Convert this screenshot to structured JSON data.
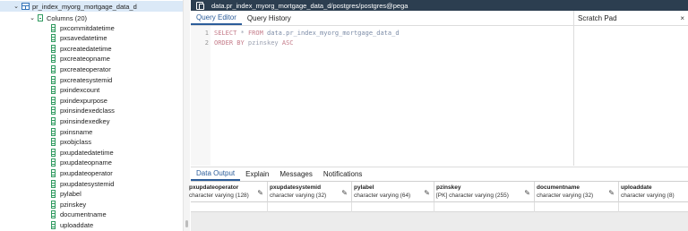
{
  "tree": {
    "table_name": "pr_index_myorg_mortgage_data_d",
    "columns_folder": "Columns (20)",
    "columns": [
      "pxcommitdatetime",
      "pxsavedatetime",
      "pxcreatedatetime",
      "pxcreateopname",
      "pxcreateoperator",
      "pxcreatesystemid",
      "pxindexcount",
      "pxindexpurpose",
      "pxinsindexedclass",
      "pxinsindexedkey",
      "pxinsname",
      "pxobjclass",
      "pxupdatedatetime",
      "pxupdateopname",
      "pxupdateoperator",
      "pxupdatesystemid",
      "pylabel",
      "pzinskey",
      "documentname",
      "uploaddate"
    ]
  },
  "titlebar": {
    "title": "data.pr_index_myorg_mortgage_data_d/postgres/postgres@pega",
    "icon": "database-icon"
  },
  "editor": {
    "tabs": [
      "Query Editor",
      "Query History"
    ],
    "active_tab": "Query Editor",
    "lines": [
      {
        "number": "1",
        "kw1": "SELECT",
        "op": " * ",
        "kw2": "FROM",
        "ident": " data.pr_index_myorg_mortgage_data_d"
      },
      {
        "number": "2",
        "kw1": "ORDER BY",
        "op": " pzinskey ",
        "kw2": "ASC",
        "ident": ""
      }
    ]
  },
  "scratch": {
    "title": "Scratch Pad",
    "close": "×"
  },
  "results": {
    "tabs": [
      "Data Output",
      "Explain",
      "Messages",
      "Notifications"
    ],
    "active_tab": "Data Output",
    "columns": [
      {
        "name": "pxupdateoperator",
        "type": "character varying (128)"
      },
      {
        "name": "pxupdatesystemid",
        "type": "character varying (32)"
      },
      {
        "name": "pylabel",
        "type": "character varying (64)"
      },
      {
        "name": "pzinskey",
        "type": "[PK] character varying (255)"
      },
      {
        "name": "documentname",
        "type": "character varying (32)"
      },
      {
        "name": "uploaddate",
        "type": "character varying (8)"
      }
    ]
  },
  "colors": {
    "titlebar_bg": "#2c3e50",
    "tab_active": "#2c5d9a",
    "tree_selected_bg": "#dbe9f7",
    "column_icon": "#2f9a5f",
    "table_icon": "#3273b9"
  }
}
